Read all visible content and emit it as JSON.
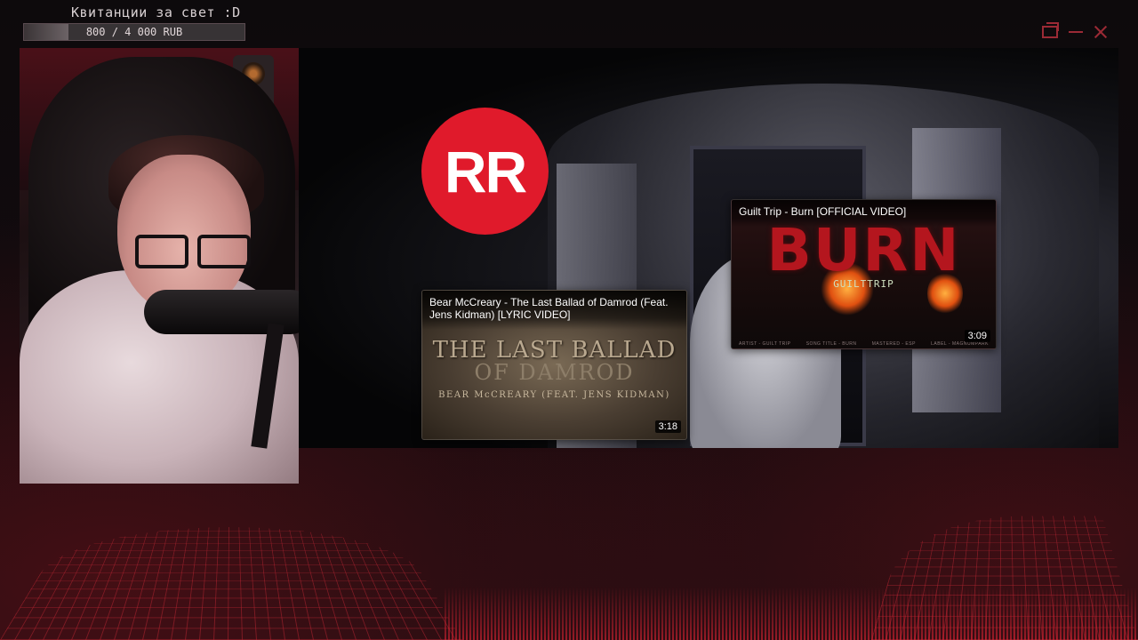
{
  "donation": {
    "title": "Квитанции за свет :D",
    "amount": "800 / 4 000 RUB",
    "progress": 0.2
  },
  "logo": {
    "text": "RR"
  },
  "cards": {
    "ballad": {
      "title": "Bear McCreary - The Last Ballad of Damrod (Feat. Jens Kidman) [LYRIC VIDEO]",
      "art_line1": "THE LAST BALLAD",
      "art_line2": "OF DAMROD",
      "art_line3": "BEAR McCREARY (FEAT. JENS KIDMAN)",
      "duration": "3:18"
    },
    "burn": {
      "title": "Guilt Trip - Burn [OFFICIAL VIDEO]",
      "art_word": "BURN",
      "art_sub": "GUILTTRIP",
      "duration": "3:09",
      "credits": [
        "ARTIST - GUILT TRIP",
        "SONG TITLE - BURN",
        "MASTERED - ESP",
        "LABEL - MAGNUMPARK"
      ]
    }
  },
  "colors": {
    "accent_red": "#e01a2b",
    "overlay_red": "#9b2a35"
  },
  "icons": [
    "restore-icon",
    "minimize-icon",
    "close-icon"
  ]
}
